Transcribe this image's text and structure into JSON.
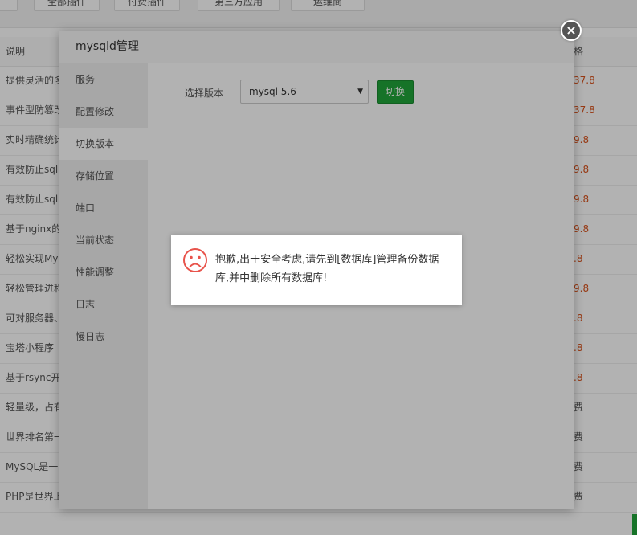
{
  "background": {
    "top_buttons": [
      "",
      "全部插件",
      "付费插件",
      "第三方应用",
      "运维商"
    ],
    "headers": {
      "desc": "说明",
      "price": "格"
    },
    "rows": [
      {
        "desc": "提供灵活的多",
        "price": "37.8"
      },
      {
        "desc": "事件型防篡改",
        "price": "37.8"
      },
      {
        "desc": "实时精确统计",
        "price": "9.8"
      },
      {
        "desc": "有效防止sql",
        "price": "9.8"
      },
      {
        "desc": "有效防止sql",
        "price": "9.8"
      },
      {
        "desc": "基于nginx的",
        "price": "9.8"
      },
      {
        "desc": "轻松实现My",
        "price": ".8"
      },
      {
        "desc": "轻松管理进程",
        "price": "9.8"
      },
      {
        "desc": "可对服务器、",
        "price": ".8"
      },
      {
        "desc": "宝塔小程序",
        "price": ".8"
      },
      {
        "desc": "基于rsync开",
        "price": ".8"
      },
      {
        "desc": "轻量级，占有",
        "price": "费"
      },
      {
        "desc": "世界排名第一",
        "price": "费"
      },
      {
        "desc": "MySQL是一",
        "price": "费"
      },
      {
        "desc": "PHP是世界上",
        "price": "费"
      }
    ]
  },
  "modal": {
    "title": "mysqld管理",
    "close_glyph": "×",
    "sidebar": [
      "服务",
      "配置修改",
      "切换版本",
      "存储位置",
      "端口",
      "当前状态",
      "性能调整",
      "日志",
      "慢日志"
    ],
    "active_index": 2,
    "version_label": "选择版本",
    "version_value": "mysql 5.6",
    "switch_label": "切换"
  },
  "alert": {
    "icon": "sad-face-icon",
    "message": "抱歉,出于安全考虑,请先到[数据库]管理备份数据库,并中删除所有数据库!"
  },
  "colors": {
    "accent": "#20a53a",
    "price": "#d9531e",
    "icon": "#e8544c"
  }
}
